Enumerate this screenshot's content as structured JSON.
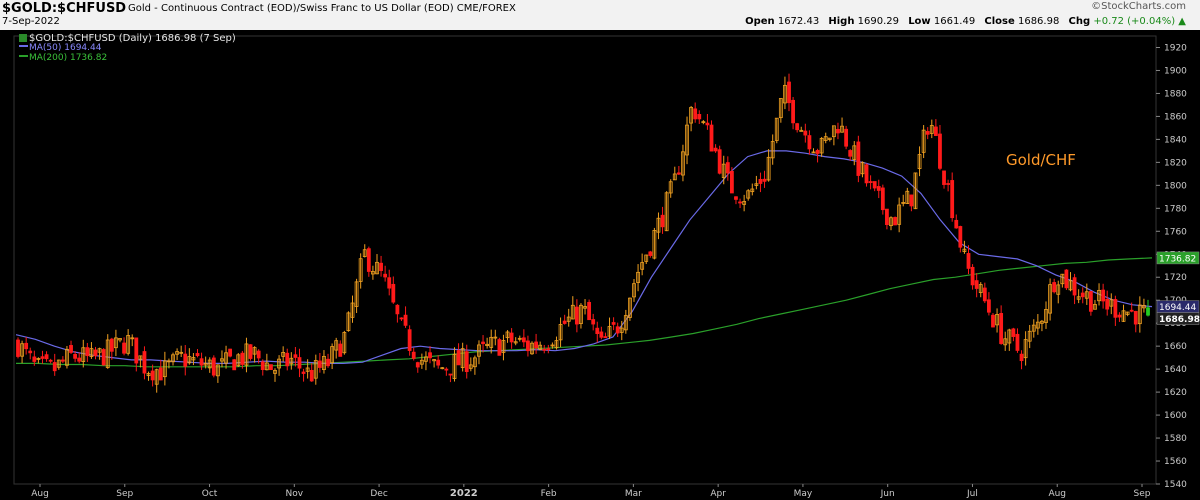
{
  "header": {
    "symbol": "$GOLD:$CHFUSD",
    "description": "Gold - Continuous Contract (EOD)/Swiss Franc to US Dollar (EOD)",
    "exchange": "CME/FOREX",
    "date": "7-Sep-2022",
    "brand": "©StockCharts.com",
    "open_label": "Open",
    "open": "1672.43",
    "high_label": "High",
    "high": "1690.29",
    "low_label": "Low",
    "low": "1661.49",
    "close_label": "Close",
    "close": "1686.98",
    "chg_label": "Chg",
    "chg": "+0.72 (+0.04%)",
    "chg_arrow": "▲"
  },
  "legend": {
    "price": "$GOLD:$CHFUSD (Daily) 1686.98 (7 Sep)",
    "ma50": "MA(50) 1694.44",
    "ma200": "MA(200) 1736.82"
  },
  "colors": {
    "background": "#000000",
    "up": "#f0a020",
    "down": "#ff1a1a",
    "last_bar": "#22cc22",
    "ma50": "#6a6ae8",
    "ma200": "#2aa02a",
    "axis_text": "#cccccc",
    "annotation": "#ff9a2a"
  },
  "chart_data": {
    "type": "candlestick",
    "title": "",
    "annotation": "Gold/CHF",
    "y_axis": {
      "position": "right",
      "range": [
        1540,
        1930
      ],
      "ticks": [
        1540,
        1560,
        1580,
        1600,
        1620,
        1640,
        1660,
        1680,
        1700,
        1720,
        1740,
        1760,
        1780,
        1800,
        1820,
        1840,
        1860,
        1880,
        1900,
        1920
      ]
    },
    "x_labels": [
      "Aug",
      "Sep",
      "Oct",
      "Nov",
      "Dec",
      "2022",
      "Feb",
      "Mar",
      "Apr",
      "May",
      "Jun",
      "Jul",
      "Aug",
      "Sep"
    ],
    "x_label_bold": "2022",
    "price_series": {
      "name": "$GOLD:$CHFUSD (Daily)",
      "close_by_week": [
        1662,
        1640,
        1640,
        1652,
        1648,
        1655,
        1665,
        1642,
        1638,
        1650,
        1645,
        1640,
        1650,
        1652,
        1640,
        1648,
        1635,
        1645,
        1670,
        1740,
        1720,
        1675,
        1650,
        1640,
        1645,
        1650,
        1660,
        1665,
        1660,
        1665,
        1680,
        1692,
        1660,
        1680,
        1725,
        1760,
        1800,
        1870,
        1840,
        1800,
        1790,
        1810,
        1880,
        1850,
        1830,
        1855,
        1820,
        1790,
        1770,
        1790,
        1860,
        1800,
        1730,
        1700,
        1670,
        1655,
        1680,
        1725,
        1710,
        1700,
        1695,
        1690,
        1686.98
      ],
      "last_close": 1686.98
    },
    "series": [
      {
        "name": "MA(50)",
        "last": 1694.44,
        "values_by_week": [
          1670,
          1666,
          1660,
          1655,
          1652,
          1650,
          1648,
          1648,
          1647,
          1646,
          1645,
          1645,
          1646,
          1647,
          1646,
          1646,
          1645,
          1645,
          1646,
          1652,
          1658,
          1660,
          1658,
          1657,
          1656,
          1656,
          1656,
          1657,
          1656,
          1658,
          1662,
          1668,
          1690,
          1720,
          1745,
          1770,
          1790,
          1810,
          1825,
          1830,
          1830,
          1828,
          1825,
          1823,
          1820,
          1815,
          1808,
          1793,
          1770,
          1750,
          1740,
          1738,
          1736,
          1730,
          1722,
          1716,
          1707,
          1700,
          1696,
          1694.44
        ]
      },
      {
        "name": "MA(200)",
        "last": 1736.82,
        "values_by_week": [
          1645,
          1645,
          1644,
          1644,
          1643,
          1643,
          1642,
          1642,
          1642,
          1642,
          1642,
          1643,
          1643,
          1644,
          1645,
          1646,
          1647,
          1648,
          1649,
          1651,
          1653,
          1655,
          1656,
          1657,
          1658,
          1659,
          1660,
          1661,
          1663,
          1665,
          1668,
          1671,
          1675,
          1679,
          1684,
          1688,
          1692,
          1696,
          1700,
          1705,
          1710,
          1714,
          1718,
          1720,
          1723,
          1726,
          1728,
          1730,
          1732,
          1733,
          1735,
          1736,
          1736.82
        ]
      }
    ]
  }
}
